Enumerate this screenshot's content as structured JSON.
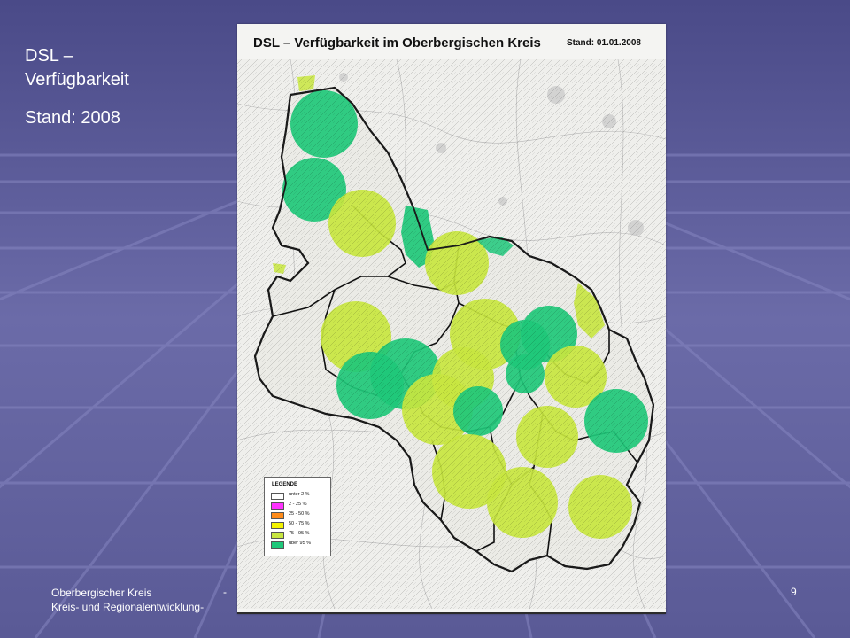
{
  "slide": {
    "title_line1": "DSL –",
    "title_line2": "Verfügbarkeit",
    "subtitle": "Stand: 2008"
  },
  "footer": {
    "org_line1": "Oberbergischer Kreis",
    "org_line2": "Kreis- und Regionalentwicklung-",
    "dash": "-",
    "page_number": "9"
  },
  "map": {
    "title": "DSL – Verfügbarkeit im Oberbergischen Kreis",
    "date": "Stand: 01.01.2008",
    "legend": {
      "title": "LEGENDE",
      "items": [
        {
          "label": "unter 2 %",
          "color": "#ffffff"
        },
        {
          "label": "2 - 25 %",
          "color": "#ff33ff"
        },
        {
          "label": "25 - 50 %",
          "color": "#ff8c1a"
        },
        {
          "label": "50 - 75 %",
          "color": "#f2f200"
        },
        {
          "label": "75 - 95 %",
          "color": "#c8e640"
        },
        {
          "label": "über 95 %",
          "color": "#1fc87a"
        }
      ]
    }
  },
  "colors": {
    "background": "#5d5d9a",
    "coverage_high": "#1fc87a",
    "coverage_mid": "#c8e640"
  }
}
